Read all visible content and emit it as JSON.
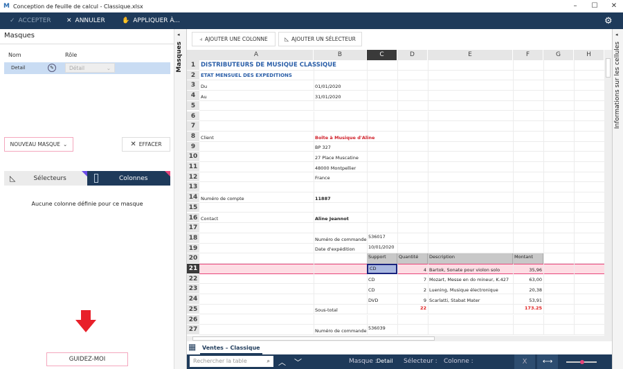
{
  "window": {
    "title": "Conception de feuille de calcul - Classique.xlsx"
  },
  "toolbar": {
    "accept": "ACCEPTER",
    "cancel": "ANNULER",
    "apply": "APPLIQUER À..."
  },
  "left": {
    "title": "Masques",
    "col_name": "Nom",
    "col_role": "Rôle",
    "row_name": "Detail",
    "row_role": "Détail",
    "new_mask": "NOUVEAU MASQUE",
    "clear": "EFFACER",
    "tab_selectors": "Sélecteurs",
    "tab_columns": "Colonnes",
    "empty": "Aucune colonne définie pour ce masque",
    "guide": "GUIDEZ-MOI"
  },
  "strip_label": "Masques",
  "right_strip_label": "Informations sur les cellules",
  "sheet": {
    "add_column": "AJOUTER UNE COLONNE",
    "add_selector": "AJOUTER UN SÉLECTEUR",
    "columns": [
      "A",
      "B",
      "C",
      "D",
      "E",
      "F",
      "G",
      "H"
    ],
    "selected_column": "C",
    "selected_row": 21,
    "rows": [
      {
        "n": 1,
        "cells": [
          {
            "c": 0,
            "t": "DISTRIBUTEURS DE MUSIQUE CLASSIQUE",
            "s": "title"
          }
        ]
      },
      {
        "n": 2,
        "cells": [
          {
            "c": 0,
            "t": "ETAT MENSUEL DES EXPEDITIONS",
            "s": "subtitle"
          }
        ]
      },
      {
        "n": 3,
        "cells": [
          {
            "c": 0,
            "t": "Du"
          },
          {
            "c": 1,
            "t": "01/01/2020"
          }
        ]
      },
      {
        "n": 4,
        "cells": [
          {
            "c": 0,
            "t": "Au"
          },
          {
            "c": 1,
            "t": "31/01/2020"
          }
        ]
      },
      {
        "n": 5,
        "cells": []
      },
      {
        "n": 6,
        "cells": []
      },
      {
        "n": 7,
        "cells": []
      },
      {
        "n": 8,
        "cells": [
          {
            "c": 0,
            "t": "Client"
          },
          {
            "c": 1,
            "t": "Boîte à Musique d'Aline",
            "s": "redbold"
          }
        ]
      },
      {
        "n": 9,
        "cells": [
          {
            "c": 1,
            "t": "BP 327"
          }
        ]
      },
      {
        "n": 10,
        "cells": [
          {
            "c": 1,
            "t": "27 Place Muscatine"
          }
        ]
      },
      {
        "n": 11,
        "cells": [
          {
            "c": 1,
            "t": "48000 Montpellier"
          }
        ]
      },
      {
        "n": 12,
        "cells": [
          {
            "c": 1,
            "t": "France"
          }
        ]
      },
      {
        "n": 13,
        "cells": []
      },
      {
        "n": 14,
        "cells": [
          {
            "c": 0,
            "t": "Numéro de compte"
          },
          {
            "c": 1,
            "t": "11887",
            "s": "bold"
          }
        ]
      },
      {
        "n": 15,
        "cells": []
      },
      {
        "n": 16,
        "cells": [
          {
            "c": 0,
            "t": "Contact"
          },
          {
            "c": 1,
            "t": "Aline Jeannot",
            "s": "bold"
          }
        ]
      },
      {
        "n": 17,
        "cells": []
      },
      {
        "n": 18,
        "cells": [
          {
            "c": 1,
            "t": "Numéro de commande"
          },
          {
            "c": 2,
            "t": "536017",
            "s": "top"
          }
        ]
      },
      {
        "n": 19,
        "cells": [
          {
            "c": 1,
            "t": "Date d'expédition"
          },
          {
            "c": 2,
            "t": "10/01/2020",
            "s": "top"
          }
        ]
      },
      {
        "n": 20,
        "cells": [
          {
            "c": 2,
            "t": "Support",
            "s": "hdr"
          },
          {
            "c": 3,
            "t": "Quantité",
            "s": "hdr"
          },
          {
            "c": 4,
            "t": "Description",
            "s": "hdr"
          },
          {
            "c": 5,
            "t": "Montant",
            "s": "hdr"
          }
        ]
      },
      {
        "n": 21,
        "cells": [
          {
            "c": 2,
            "t": "CD"
          },
          {
            "c": 3,
            "t": "4",
            "s": "right"
          },
          {
            "c": 4,
            "t": "Bartok, Sonate pour violon solo"
          },
          {
            "c": 5,
            "t": "35,96",
            "s": "right"
          }
        ]
      },
      {
        "n": 22,
        "cells": [
          {
            "c": 2,
            "t": "CD"
          },
          {
            "c": 3,
            "t": "7",
            "s": "right"
          },
          {
            "c": 4,
            "t": "Mozart, Messe en do mineur, K.427"
          },
          {
            "c": 5,
            "t": "63,00",
            "s": "right"
          }
        ]
      },
      {
        "n": 23,
        "cells": [
          {
            "c": 2,
            "t": "CD"
          },
          {
            "c": 3,
            "t": "2",
            "s": "right"
          },
          {
            "c": 4,
            "t": "Luening, Musique électronique"
          },
          {
            "c": 5,
            "t": "20,38",
            "s": "right"
          }
        ]
      },
      {
        "n": 24,
        "cells": [
          {
            "c": 2,
            "t": "DVD"
          },
          {
            "c": 3,
            "t": "9",
            "s": "right"
          },
          {
            "c": 4,
            "t": "Scarlatti, Stabat Mater"
          },
          {
            "c": 5,
            "t": "53,91",
            "s": "right"
          }
        ]
      },
      {
        "n": 25,
        "cells": [
          {
            "c": 1,
            "t": "Sous-total"
          },
          {
            "c": 3,
            "t": "22",
            "s": "redtop"
          },
          {
            "c": 5,
            "t": "173.25",
            "s": "redtop"
          }
        ]
      },
      {
        "n": 26,
        "cells": []
      },
      {
        "n": 27,
        "cells": [
          {
            "c": 1,
            "t": "Numéro de commande"
          },
          {
            "c": 2,
            "t": "536039",
            "s": "top"
          }
        ]
      }
    ],
    "sheet_tab": "Ventes – Classique"
  },
  "bottom": {
    "search_placeholder": "Rechercher la table",
    "mask_label": "Masque :",
    "mask_value": "Detail",
    "selector_label": "Sélecteur :",
    "column_label": "Colonne :"
  },
  "colors": {
    "navy": "#1e3a5a",
    "accent_pink": "#e8457a",
    "selected_row": "#fddde4",
    "title_blue": "#2b5fa8",
    "red": "#d0202a"
  }
}
